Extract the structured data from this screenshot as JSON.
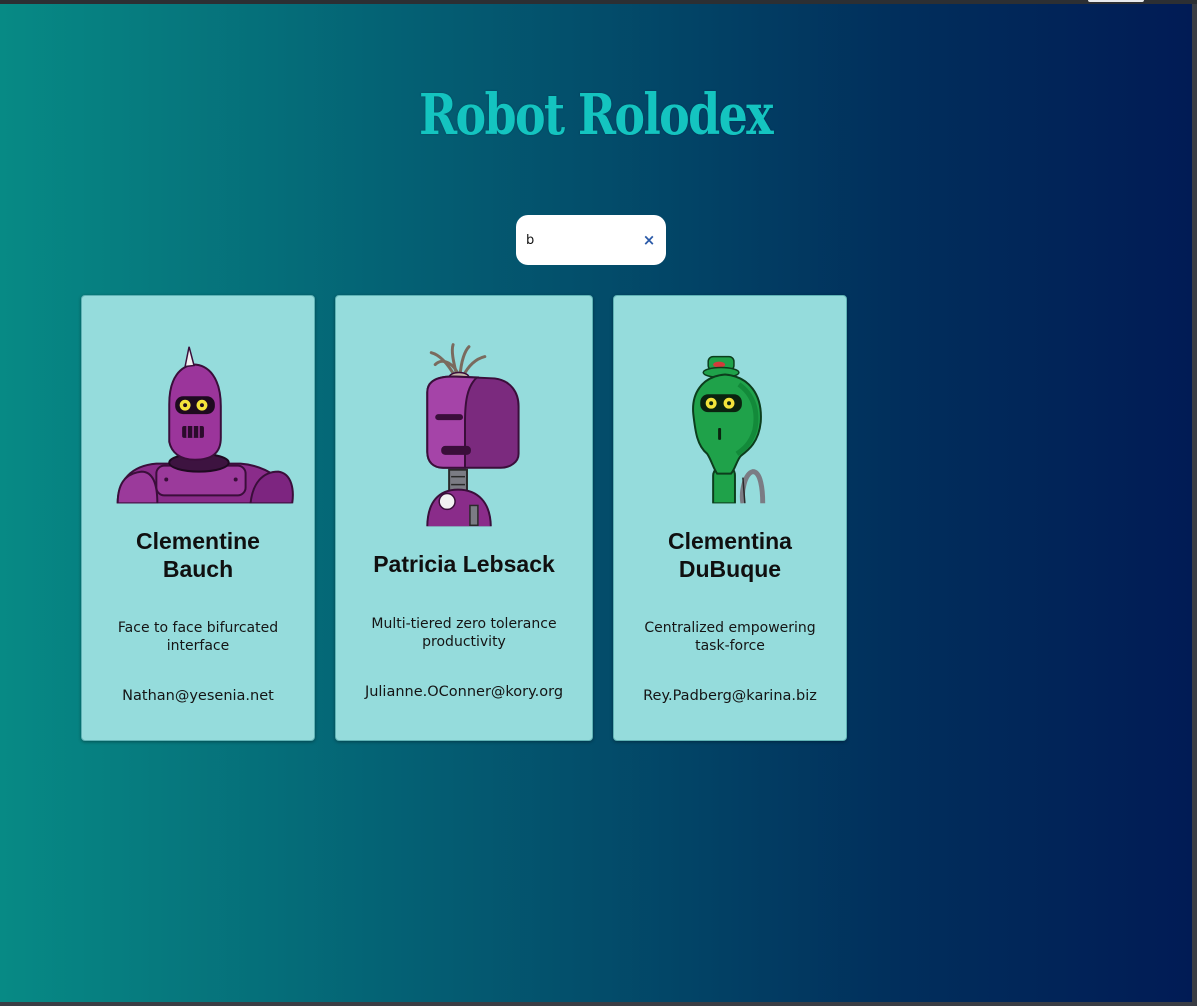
{
  "app": {
    "title": "Robot Rolodex"
  },
  "search": {
    "value": "b",
    "clear_glyph": "×"
  },
  "cards": [
    {
      "name": "Clementine Bauch",
      "catch_phrase": "Face to face bifurcated interface",
      "email": "Nathan@yesenia.net",
      "robot_icon": "purple-robot-spike-icon",
      "robot_color": "#8e2b8e"
    },
    {
      "name": "Patricia Lebsack",
      "catch_phrase": "Multi-tiered zero tolerance productivity",
      "email": "Julianne.OConner@kory.org",
      "robot_icon": "purple-robot-antenna-icon",
      "robot_color": "#8e2b8e"
    },
    {
      "name": "Clementina DuBuque",
      "catch_phrase": "Centralized empowering task-force",
      "email": "Rey.Padberg@karina.biz",
      "robot_icon": "green-robot-icon",
      "robot_color": "#1fa24a"
    }
  ],
  "colors": {
    "title": "#14c4c0",
    "card_background": "#95dcdc",
    "clear_button": "#2b5aa8"
  }
}
